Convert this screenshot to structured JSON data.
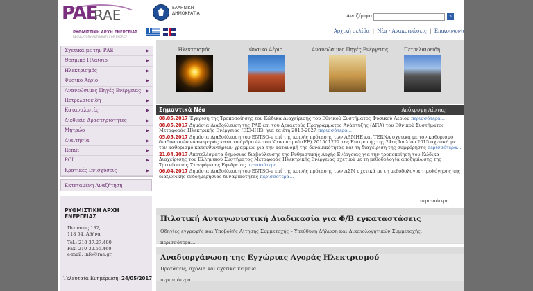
{
  "header": {
    "logo_pae": "PAE",
    "logo_rae": "RAE",
    "logo_sub1": "ΡΥΘΜΙΣΤΙΚΗ ΑΡΧΗ ΕΝΕΡΓΕΙΑΣ",
    "logo_sub2": "REGULATORY AUTHORITY FOR ENERGY",
    "gov_line1": "ΕΛΛΗΝΙΚΗ",
    "gov_line2": "ΔΗΜΟΚΡΑΤΙΑ",
    "search_label": "Αναζήτηση",
    "search_value": "",
    "search_button": "»",
    "links": [
      "Αρχική σελίδα",
      "Νέα - Ανακοινώσεις",
      "Επικοινωνία"
    ],
    "link_sep": "|"
  },
  "menu": {
    "items": [
      {
        "label": "Σχετικά με την ΡΑΕ",
        "arrow": "▶"
      },
      {
        "label": "Θεσμικό Πλαίσιο",
        "arrow": "▶"
      },
      {
        "label": "Ηλεκτρισμός",
        "arrow": "▶"
      },
      {
        "label": "Φυσικό Αέριο",
        "arrow": "▶"
      },
      {
        "label": "Ανανεώσιμες Πηγές Ενέργειας",
        "arrow": "▶"
      },
      {
        "label": "Πετρελαιοειδή",
        "arrow": "▶"
      },
      {
        "label": "Καταναλωτές",
        "arrow": "▶"
      },
      {
        "label": "Διεθνείς Δραστηριότητες",
        "arrow": "▶"
      },
      {
        "label": "Μητρώο",
        "arrow": "▶"
      },
      {
        "label": "Διαιτησία",
        "arrow": "▶"
      },
      {
        "label": "Remit",
        "arrow": "▶"
      },
      {
        "label": "PCI",
        "arrow": "▶"
      },
      {
        "label": "Κρατικές Ενισχύσεις",
        "arrow": "▶"
      }
    ],
    "advanced_search": "Εκτεταμένη Αναζήτηση"
  },
  "address": {
    "org_line1": "ΡΥΘΜΙΣΤΙΚΗ ΑΡΧΗ",
    "org_line2": "ΕΝΕΡΓΕΙΑΣ",
    "street": "Πειραιώς 132,",
    "city": "118 54, Αθήνα",
    "tel": "Tel.: 210-37.27.400",
    "fax": "Fax: 210-32.55.460",
    "email": "e-mail: info@rae.gr",
    "last_update_label": "Τελευταία Ενημέρωση:",
    "last_update_date": "24/05/2017"
  },
  "categories": [
    {
      "label": "Ηλεκτρισμός"
    },
    {
      "label": "Φυσικό Αέριο"
    },
    {
      "label": "Ανανεώσιμες Πηγές Ενέργειας"
    },
    {
      "label": "Πετρελαιοειδή"
    }
  ],
  "news": {
    "title": "Σημαντικά Νέα",
    "list_link": "Απόκρυψη Λίστας",
    "items": [
      {
        "date": "08.05.2017",
        "text": "Έγκριση της Τροποποίησης του Κώδικα Διαχείρισης του Εθνικού Συστήματος Φυσικού Αερίου",
        "more": "περισσότερα..."
      },
      {
        "date": "08.05.2017",
        "text": "Δημόσια Διαβούλευση της ΡΑΕ επί του Δεκαετούς Προγράμματος Ανάπτυξης (ΔΠΑ) του Εθνικού Συστήματος Μεταφοράς Ηλεκτρικής Ενέργειας (ΕΣΜΗΕ), για τα έτη 2018-2027",
        "more": "περισσότερα..."
      },
      {
        "date": "05.05.2017",
        "text": "Δημόσια Διαβούλευση του ENTSO-e επί της κοινής πρότασης των ΑΔΜΗΕ και TERNA σχετικά με τον καθορισμό διαδικασιών επαναφοράς κατά το άρθρο 44 του Κανονισμού (ΕΕ) 2015/ 1222 της Επιτροπής της 24ης Ιουλίου 2015 σχετικά με τον καθορισμό κατευθυντήριων γραμμών για την κατανομή της δυναμικότητας και τη διαχείριση της συμφόρησης",
        "more": "περισσότερα..."
      },
      {
        "date": "21.04.2017",
        "text": "Αποτελέσματα δημόσιας διαβούλευσης της Ρυθμιστικής Αρχής Ενέργειας για την τροποποίηση του Κώδικα Διαχείρισης του Ελληνικού Συστήματος Μεταφοράς Ηλεκτρικής Ενέργειας σχετικά με τη μεθοδολογία αποζημίωσης της Τριτεύουσας Στρεφόμενης Εφεδρείας",
        "more": "περισσότερα..."
      },
      {
        "date": "06.04.2017",
        "text": "Δημόσια Διαβούλευση του ENTSO-e επί της κοινής πρότασης των ΔΣΜ σχετικά με τη μεθοδολογία τιμολόγησης της διαζωνικής ενδοημερήσιας δυναμικότητας",
        "more": "περισσότερα..."
      }
    ],
    "more": "περισσότερα..."
  },
  "boxes": [
    {
      "title": "Πιλοτική Ανταγωνιστική Διαδικασία για Φ/Β εγκαταστάσεις",
      "text": "Οδηγίες εγγραφής και Υποβολής Αίτησης Συμμετοχής – Υπεύθυνη Δήλωση και Δικαιολογητικών Συμμετοχής.",
      "more": "περισσότερα..."
    },
    {
      "title": "Αναδιοργάνωση της Εγχώριας Αγοράς Ηλεκτρισμού",
      "text": "Προτάσεις, σχόλια και σχετικά κείμενα.",
      "more": "περισσότερα..."
    }
  ]
}
